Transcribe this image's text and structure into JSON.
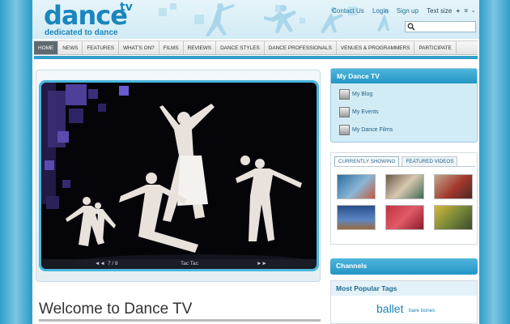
{
  "header": {
    "logo_word": "dance",
    "logo_tv": "tv",
    "tagline": "dedicated to dance",
    "links": {
      "contact": "Contact Us",
      "login": "Login",
      "signup": "Sign up",
      "text_size": "Text size",
      "increase": "+",
      "reset": "=",
      "decrease": "-"
    }
  },
  "nav": {
    "items": [
      "HOME",
      "NEWS",
      "FEATURES",
      "WHAT'S ON?",
      "FILMS",
      "REVIEWS",
      "DANCE STYLES",
      "DANCE PROFESSIONALS",
      "VENUES & PROGRAMMERS",
      "PARTICIPATE"
    ],
    "active_index": 0
  },
  "video": {
    "prev": "◄◄",
    "counter": "7 / 8",
    "title": "Tac Tac",
    "next": "►►"
  },
  "welcome": "Welcome to Dance TV",
  "my_dance_tv": {
    "title": "My Dance TV",
    "items": [
      "My Blog",
      "My Events",
      "My Dance Films"
    ]
  },
  "videos_panel": {
    "tabs": [
      "CURRENTLY SHOWING",
      "FEATURED VIDEOS"
    ],
    "active_tab": 0
  },
  "channels": {
    "title": "Channels"
  },
  "tags": {
    "title": "Most Popular Tags",
    "big": "ballet",
    "small": "bare bones"
  },
  "colors": {
    "brand": "#1a86bd",
    "accent": "#2f9fc9",
    "nav_active": "#5e6a70"
  }
}
